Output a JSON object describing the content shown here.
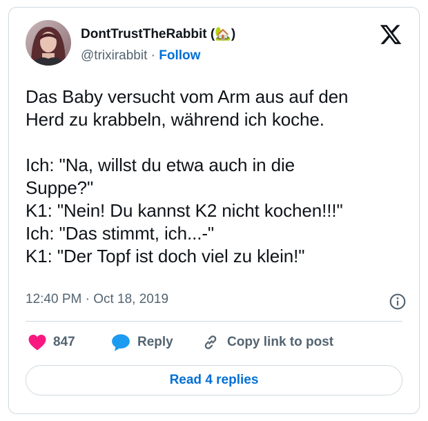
{
  "author": {
    "display_name": "DontTrustTheRabbit (🏡)",
    "handle": "@trixirabbit",
    "separator": "·",
    "follow_label": "Follow"
  },
  "tweet": {
    "text": "Das Baby versucht vom Arm aus auf den\nHerd zu krabbeln, während ich koche.\n\nIch: \"Na, willst du etwa auch in die\nSuppe?\"\nK1: \"Nein! Du kannst K2 nicht kochen!!!\"\nIch: \"Das stimmt, ich...-\"\nK1: \"Der Topf ist doch viel zu klein!\"",
    "timestamp": "12:40 PM · Oct 18, 2019"
  },
  "actions": {
    "like_count": "847",
    "reply_label": "Reply",
    "copy_link_label": "Copy link to post"
  },
  "replies_button": "Read 4 replies",
  "colors": {
    "like": "#f91880",
    "reply": "#1d9bf0",
    "link": "#006fd6",
    "muted": "#536471",
    "border": "#cfd9de"
  },
  "icons": [
    "x-logo-icon",
    "info-icon",
    "heart-icon",
    "reply-bubble-icon",
    "link-icon"
  ]
}
